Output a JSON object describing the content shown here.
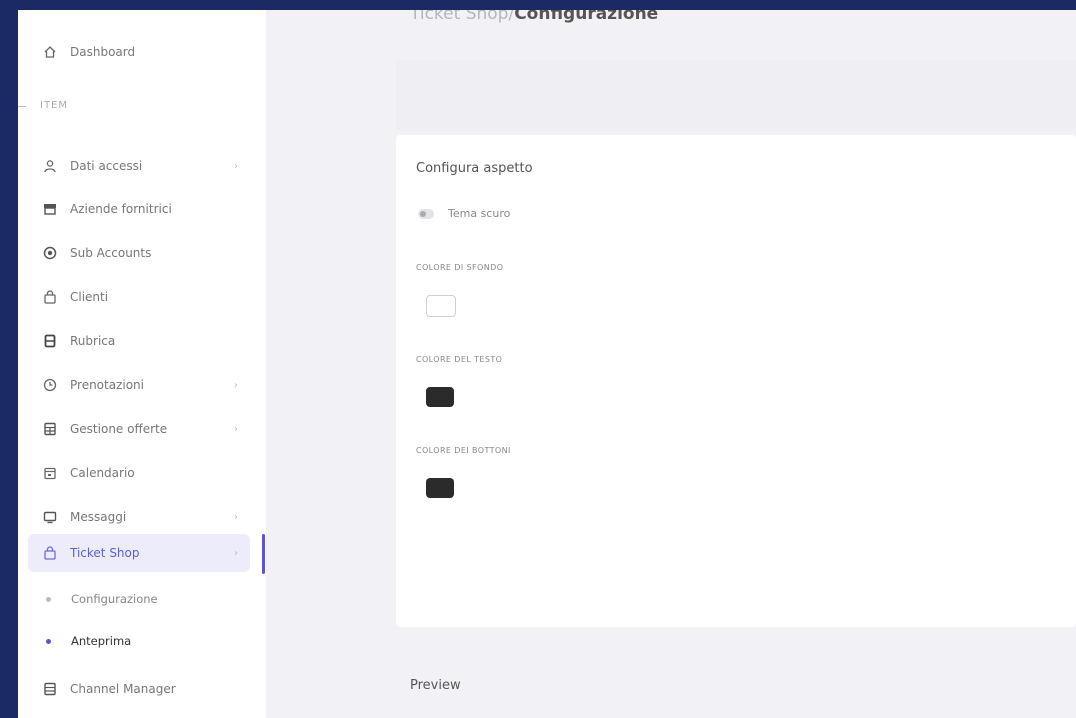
{
  "breadcrumb": {
    "parent": "Ticket Shop/",
    "current": "Configurazione"
  },
  "sidebar": {
    "dashboard": "Dashboard",
    "section": "ITEM",
    "items": [
      {
        "label": "Dati accessi",
        "icon": "user-icon",
        "chevron": true
      },
      {
        "label": "Aziende fornitrici",
        "icon": "store-icon",
        "chevron": false
      },
      {
        "label": "Sub Accounts",
        "icon": "globe-icon",
        "chevron": false
      },
      {
        "label": "Clienti",
        "icon": "bag-icon",
        "chevron": false
      },
      {
        "label": "Rubrica",
        "icon": "book-icon",
        "chevron": false
      },
      {
        "label": "Prenotazioni",
        "icon": "clock-icon",
        "chevron": true
      },
      {
        "label": "Gestione offerte",
        "icon": "grid-icon",
        "chevron": true
      },
      {
        "label": "Calendario",
        "icon": "calendar-icon",
        "chevron": false
      },
      {
        "label": "Messaggi",
        "icon": "message-icon",
        "chevron": true
      },
      {
        "label": "Ticket Shop",
        "icon": "shop-icon",
        "chevron": true,
        "active": true
      }
    ],
    "sub_items": [
      {
        "label": "Configurazione",
        "current": false
      },
      {
        "label": "Anteprima",
        "current": true
      }
    ],
    "last_item": "Channel Manager"
  },
  "config": {
    "title": "Configura aspetto",
    "toggle_label": "Tema scuro",
    "fields": [
      {
        "label": "COLORE DI SFONDO",
        "color": "#ffffff"
      },
      {
        "label": "COLORE DEL TESTO",
        "color": "#2b2b2b"
      },
      {
        "label": "COLORE DEI BOTTONI",
        "color": "#2b2b2b"
      }
    ]
  },
  "preview_title": "Preview",
  "colors": {
    "accent": "#5b55d6",
    "frame": "#1b2a63"
  }
}
